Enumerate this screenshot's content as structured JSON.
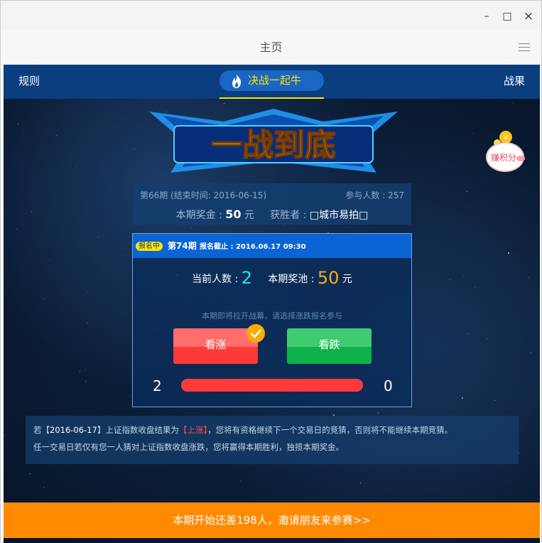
{
  "window": {
    "minimize_glyph": "–",
    "maximize_glyph": "□",
    "close_glyph": "×"
  },
  "nav": {
    "title": "主页",
    "menu_icon": "hamburger-menu-icon"
  },
  "topbar": {
    "left_label": "规则",
    "center_tab": "决战一起牛",
    "right_label": "战果",
    "accent_color": "#ffe400"
  },
  "logo": {
    "text": "一战到底"
  },
  "piggy": {
    "label": "赚积分",
    "coin_symbol": "¥"
  },
  "previous": {
    "period": "第66期 (结束时间: 2016-06-15)",
    "participants": "参与人数 : 257",
    "prize_label": "本期奖金 :",
    "prize_value": "50",
    "prize_unit": "元",
    "winner_label": "获胜者 :",
    "winner_name": "□城市易拍□"
  },
  "current": {
    "badge": "报名中",
    "period": "第74期",
    "deadline": "报名截止 : 2016.06.17 09:30",
    "count_label": "当前人数 :",
    "count_value": "2",
    "pool_label": "本期奖池 :",
    "pool_value": "50",
    "pool_unit": "元",
    "hint": "本期即将拉开战幕，请选择涨跌报名参与",
    "up_button": "看涨",
    "down_button": "看跌",
    "up_count": "2",
    "down_count": "0",
    "up_fraction": 1.0,
    "up_color": "#ff3a3a",
    "down_color": "#0fb24a"
  },
  "notice": {
    "line1_pre": "若【",
    "line1_date": "2016-06-17",
    "line1_mid": "】上证指数收盘结果为",
    "line1_hl": "【上涨】",
    "line1_post": "，您将有资格继续下一个交易日的竞猜，否则将不能继续本期竞猜。",
    "line2": "任一交易日若仅有您一人猜对上证指数收盘涨跌，您将赢得本期胜利，独揽本期奖金。"
  },
  "invite": {
    "text": "本期开始还差198人，邀请朋友来参赛>>",
    "color": "#ff8a00"
  }
}
